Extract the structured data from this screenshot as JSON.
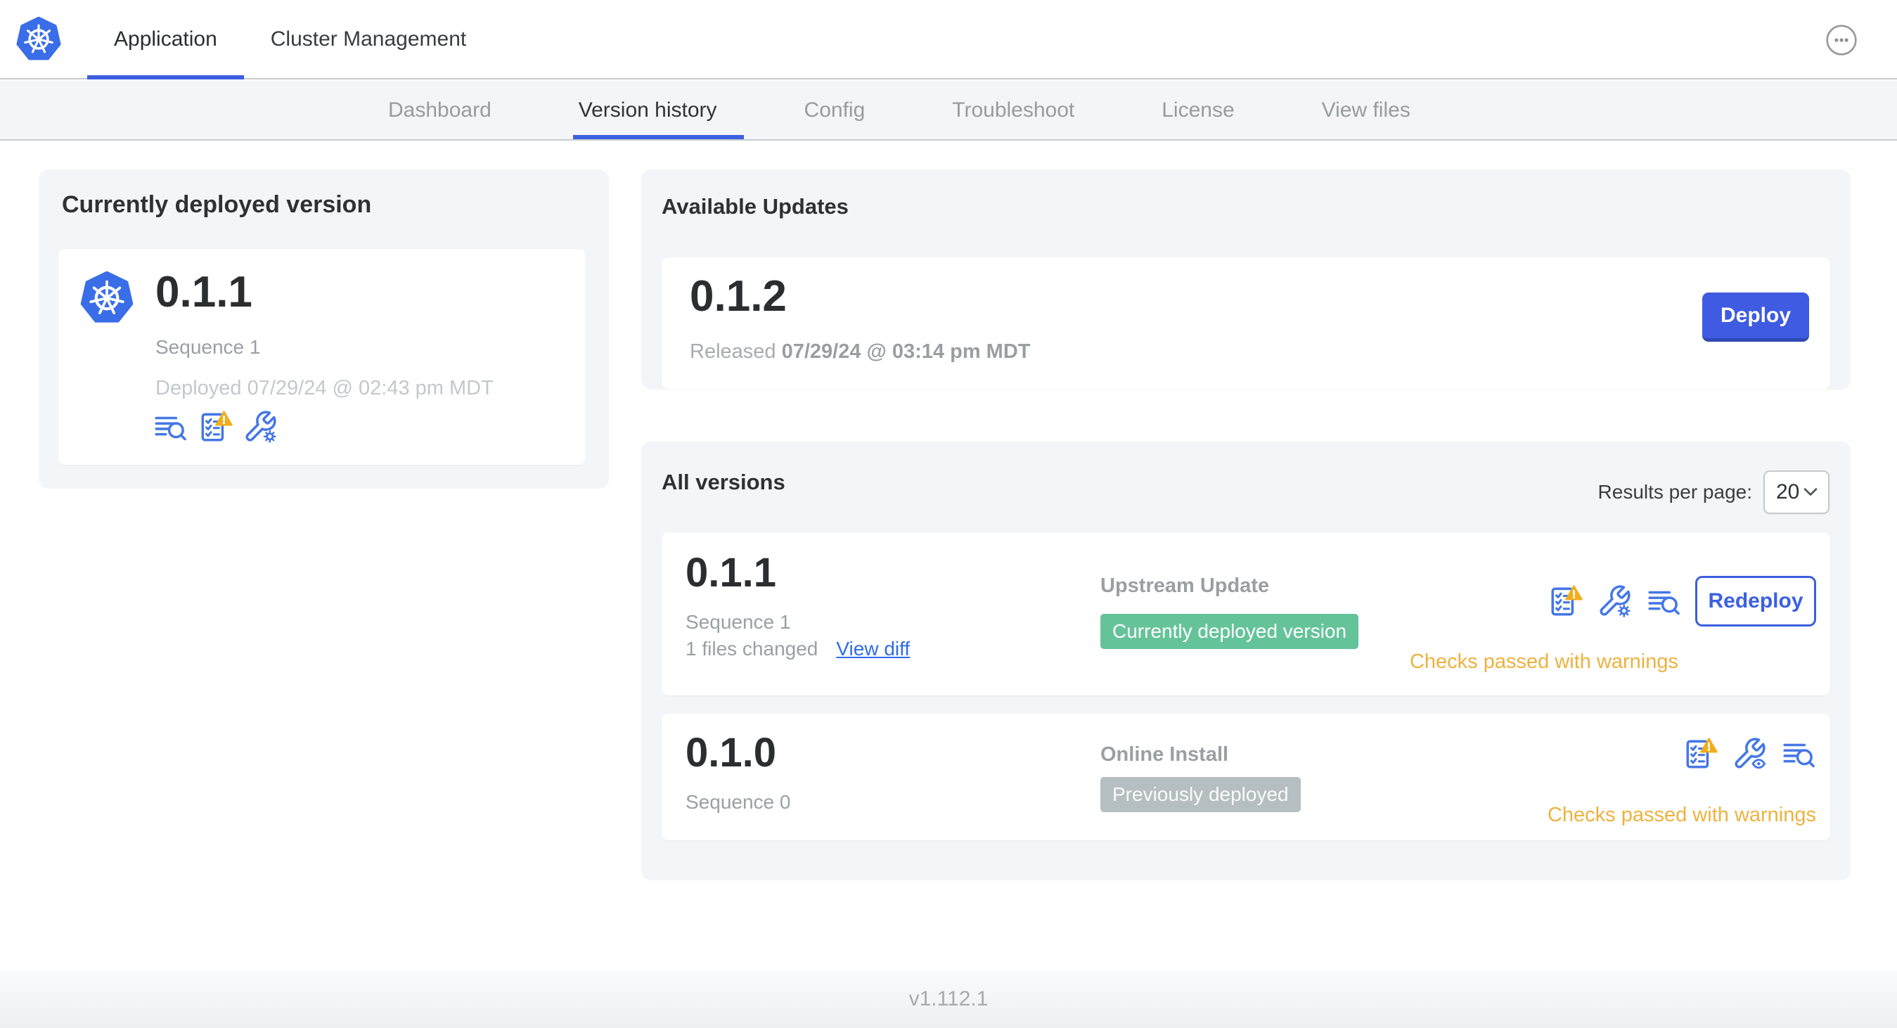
{
  "header": {
    "tabs": [
      {
        "label": "Application",
        "active": true
      },
      {
        "label": "Cluster Management",
        "active": false
      }
    ],
    "more_menu_icon": "ellipsis-circle-icon"
  },
  "subnav": {
    "tabs": [
      {
        "label": "Dashboard",
        "active": false
      },
      {
        "label": "Version history",
        "active": true
      },
      {
        "label": "Config",
        "active": false
      },
      {
        "label": "Troubleshoot",
        "active": false
      },
      {
        "label": "License",
        "active": false
      },
      {
        "label": "View files",
        "active": false
      }
    ]
  },
  "currently_deployed": {
    "title": "Currently deployed version",
    "app_icon": "kubernetes-logo-icon",
    "version": "0.1.1",
    "sequence": "Sequence 1",
    "deployed_at": "Deployed 07/29/24 @ 02:43 pm MDT",
    "icons": [
      "release-notes-icon",
      "preflight-checks-warning-icon",
      "edit-config-icon"
    ]
  },
  "available_updates": {
    "title": "Available Updates",
    "version": "0.1.2",
    "released_label": "Released",
    "released_at": "07/29/24 @ 03:14 pm MDT",
    "deploy_label": "Deploy"
  },
  "all_versions": {
    "title": "All versions",
    "results_per_page_label": "Results per page:",
    "results_per_page_value": "20",
    "rows": [
      {
        "version": "0.1.1",
        "sequence": "Sequence 1",
        "files_changed": "1 files changed",
        "view_diff_label": "View diff",
        "source": "Upstream Update",
        "badge": "Currently deployed version",
        "badge_type": "green",
        "icons": [
          "preflight-checks-warning-icon",
          "edit-config-icon",
          "release-notes-icon"
        ],
        "action_label": "Redeploy",
        "checks_text": "Checks passed with warnings"
      },
      {
        "version": "0.1.0",
        "sequence": "Sequence 0",
        "source": "Online Install",
        "badge": "Previously deployed",
        "badge_type": "gray",
        "icons": [
          "preflight-checks-warning-icon",
          "view-config-icon",
          "release-notes-icon"
        ],
        "checks_text": "Checks passed with warnings"
      }
    ]
  },
  "footer": {
    "version": "v1.112.1"
  },
  "colors": {
    "accent_blue": "#3c5fe0",
    "icon_blue": "#4577e6",
    "link_blue": "#2f6ce8",
    "k8s_blue": "#3a6de8",
    "green_badge": "#65c39a",
    "gray_badge": "#b5bec1",
    "warning_text": "#edb23f",
    "warning_triangle": "#f0ad1c"
  }
}
